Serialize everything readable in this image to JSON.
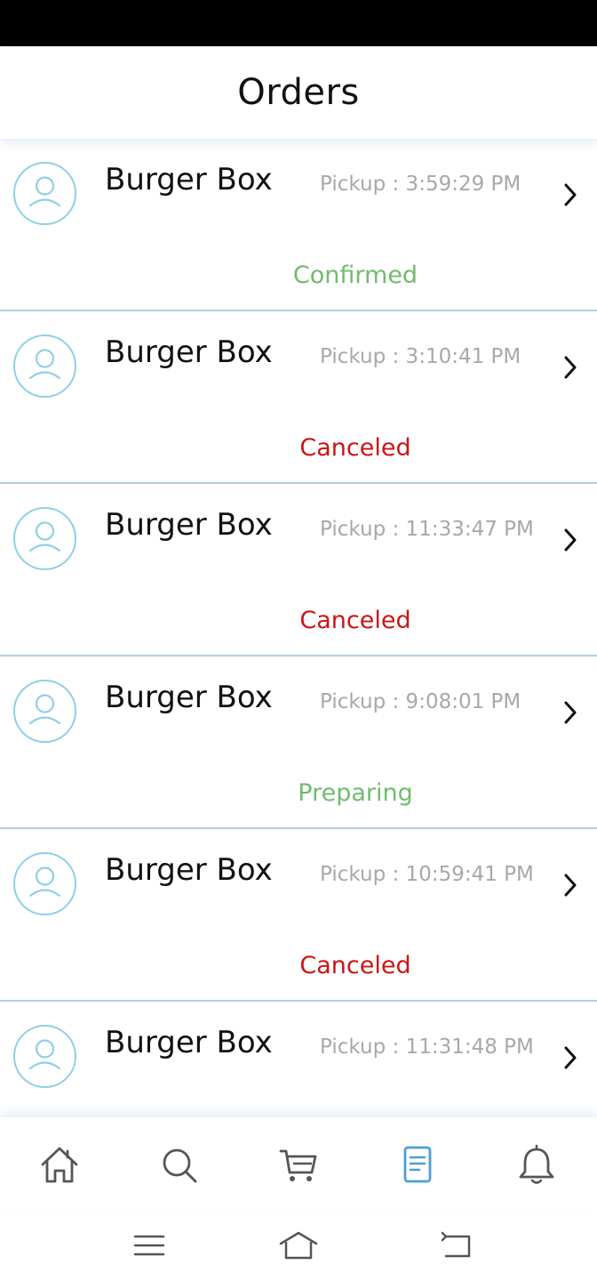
{
  "header": {
    "title": "Orders"
  },
  "orders": [
    {
      "restaurant": "Burger Box",
      "pickup": "Pickup : 3:59:29 PM",
      "status": "Confirmed",
      "status_type": "confirmed"
    },
    {
      "restaurant": "Burger Box",
      "pickup": "Pickup : 3:10:41 PM",
      "status": "Canceled",
      "status_type": "canceled"
    },
    {
      "restaurant": "Burger Box",
      "pickup": "Pickup : 11:33:47 PM",
      "status": "Canceled",
      "status_type": "canceled"
    },
    {
      "restaurant": "Burger Box",
      "pickup": "Pickup : 9:08:01 PM",
      "status": "Preparing",
      "status_type": "preparing"
    },
    {
      "restaurant": "Burger Box",
      "pickup": "Pickup : 10:59:41 PM",
      "status": "Canceled",
      "status_type": "canceled"
    },
    {
      "restaurant": "Burger Box",
      "pickup": "Pickup : 11:31:48 PM",
      "status": "",
      "status_type": ""
    }
  ],
  "tabs": [
    {
      "icon": "home-icon",
      "active": false
    },
    {
      "icon": "search-icon",
      "active": false
    },
    {
      "icon": "cart-icon",
      "active": false
    },
    {
      "icon": "orders-icon",
      "active": true
    },
    {
      "icon": "bell-icon",
      "active": false
    }
  ],
  "colors": {
    "confirmed": "#72bb6f",
    "preparing": "#72bb6f",
    "canceled": "#cc1414",
    "accent": "#4a9fd8",
    "divider": "#a9d3e6"
  },
  "system_nav": [
    "menu-icon",
    "home-outline-icon",
    "back-icon"
  ]
}
